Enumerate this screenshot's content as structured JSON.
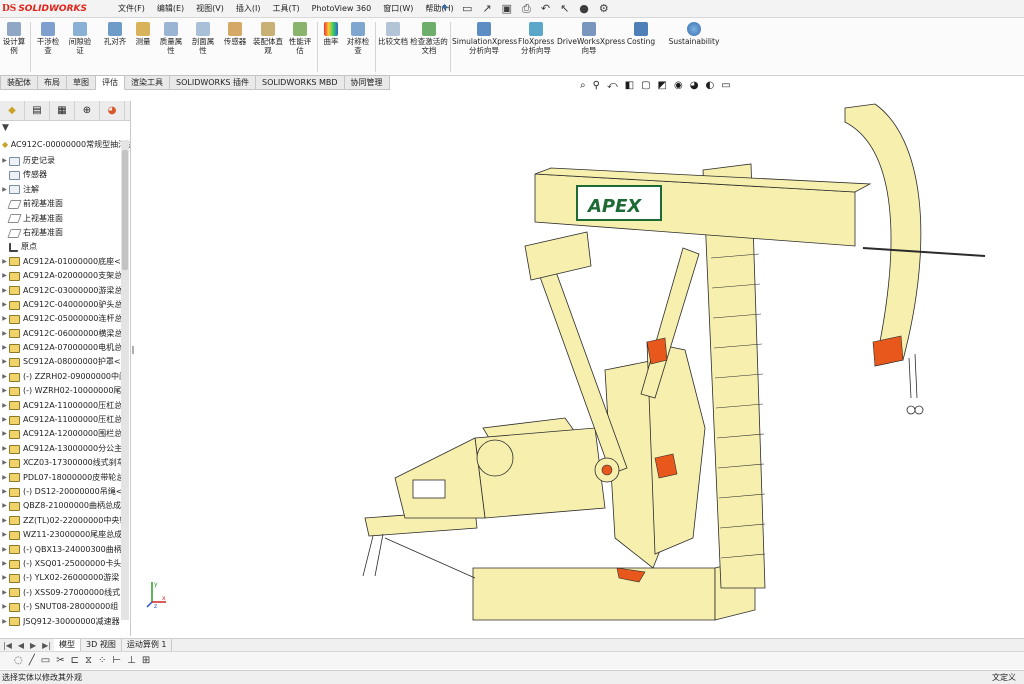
{
  "app": {
    "brand_ds": "DS",
    "brand_name": "SOLIDWORKS"
  },
  "menu": [
    "文件(F)",
    "编辑(E)",
    "视图(V)",
    "插入(I)",
    "工具(T)",
    "PhotoView 360",
    "窗口(W)",
    "帮助(H)"
  ],
  "quick_access": [
    "new-icon",
    "open-icon",
    "save-icon",
    "print-icon",
    "undo-icon",
    "select-icon",
    "rebuild-icon",
    "options-icon"
  ],
  "ribbon_tools": [
    {
      "label": "设计算例",
      "icon": "study-icon"
    },
    {
      "label": "干涉检查",
      "icon": "interference-icon"
    },
    {
      "label": "间隙验证",
      "icon": "clearance-icon"
    },
    {
      "label": "孔对齐",
      "icon": "hole-align-icon"
    },
    {
      "label": "测量",
      "icon": "measure-icon"
    },
    {
      "label": "质量属性",
      "icon": "mass-props-icon"
    },
    {
      "label": "剖面属性",
      "icon": "section-props-icon"
    },
    {
      "label": "传感器",
      "icon": "sensor-icon"
    },
    {
      "label": "装配体直观",
      "icon": "assembly-visual-icon"
    },
    {
      "label": "性能评估",
      "icon": "performance-icon"
    },
    {
      "label": "曲率",
      "icon": "curvature-icon"
    },
    {
      "label": "对称检查",
      "icon": "symmetry-icon"
    },
    {
      "label": "比较文档",
      "icon": "compare-icon"
    },
    {
      "label": "检查激活的文档",
      "icon": "check-doc-icon"
    },
    {
      "label": "SimulationXpress 分析向导",
      "icon": "simxpress-icon"
    },
    {
      "label": "FloXpress 分析向导",
      "icon": "floxpress-icon"
    },
    {
      "label": "DriveWorksXpress 向导",
      "icon": "driveworks-icon"
    },
    {
      "label": "Costing",
      "icon": "costing-icon"
    },
    {
      "label": "Sustainability",
      "icon": "sustainability-icon"
    }
  ],
  "tabs": [
    "装配体",
    "布局",
    "草图",
    "评估",
    "渲染工具",
    "SOLIDWORKS 插件",
    "SOLIDWORKS MBD",
    "协同管理"
  ],
  "active_tab": "评估",
  "view_toolbar": [
    "zoom-fit-icon",
    "zoom-area-icon",
    "previous-view-icon",
    "section-view-icon",
    "view-orientation-icon",
    "display-style-icon",
    "hide-show-icon",
    "edit-appearance-icon",
    "apply-scene-icon",
    "view-settings-icon"
  ],
  "panel_tabs": [
    "feature-manager-icon",
    "property-manager-icon",
    "config-manager-icon",
    "dimxpert-icon",
    "display-manager-icon"
  ],
  "tree": {
    "root": "AC912C-00000000常规型抽油机",
    "items": [
      {
        "label": "历史记录",
        "type": "feat",
        "expand": true
      },
      {
        "label": "传感器",
        "type": "feat",
        "expand": false
      },
      {
        "label": "注解",
        "type": "feat",
        "expand": true
      },
      {
        "label": "前视基准面",
        "type": "plane",
        "expand": false
      },
      {
        "label": "上视基准面",
        "type": "plane",
        "expand": false
      },
      {
        "label": "右视基准面",
        "type": "plane",
        "expand": false
      },
      {
        "label": "原点",
        "type": "origin",
        "expand": false
      },
      {
        "label": "AC912A-01000000底座<",
        "type": "part",
        "expand": true
      },
      {
        "label": "AC912A-02000000支架总",
        "type": "part",
        "expand": true
      },
      {
        "label": "AC912C-03000000游梁总",
        "type": "part",
        "expand": true
      },
      {
        "label": "AC912C-04000000驴头总",
        "type": "part",
        "expand": true
      },
      {
        "label": "AC912C-05000000连杆总",
        "type": "part",
        "expand": true
      },
      {
        "label": "AC912C-06000000横梁总",
        "type": "part",
        "expand": true
      },
      {
        "label": "AC912A-07000000电机总",
        "type": "part",
        "expand": true
      },
      {
        "label": "SC912A-08000000护罩<",
        "type": "part",
        "expand": true
      },
      {
        "label": "(-) ZZRH02-09000000中间",
        "type": "part",
        "expand": true
      },
      {
        "label": "(-) WZRH02-10000000尾",
        "type": "part",
        "expand": true
      },
      {
        "label": "AC912A-11000000压杠总",
        "type": "part",
        "expand": true
      },
      {
        "label": "AC912A-11000000压杠总",
        "type": "part",
        "expand": true
      },
      {
        "label": "AC912A-12000000围栏总",
        "type": "part",
        "expand": true
      },
      {
        "label": "AC912A-13000000分公主",
        "type": "part",
        "expand": true
      },
      {
        "label": "XCZ03-17300000线式刹车",
        "type": "part",
        "expand": true
      },
      {
        "label": "PDL07-18000000皮带轮总",
        "type": "part",
        "expand": true
      },
      {
        "label": "(-) DS12-20000000吊绳<",
        "type": "part",
        "expand": true
      },
      {
        "label": "QBZ8-21000000曲柄总成",
        "type": "part",
        "expand": true
      },
      {
        "label": "ZZ(TL)02-22000000中央轴",
        "type": "part",
        "expand": true
      },
      {
        "label": "WZ11-23000000尾座总成",
        "type": "part",
        "expand": true
      },
      {
        "label": "(-) QBX13-24000300曲柄",
        "type": "part",
        "expand": true
      },
      {
        "label": "(-) XSQ01-25000000卡头",
        "type": "part",
        "expand": true
      },
      {
        "label": "(-) YLX02-26000000游梁",
        "type": "part",
        "expand": true
      },
      {
        "label": "(-) XSS09-27000000线式",
        "type": "part",
        "expand": true
      },
      {
        "label": "(-) SNUT08-28000000组",
        "type": "part",
        "expand": true
      },
      {
        "label": "JSQ912-30000000减速器",
        "type": "part",
        "expand": true
      }
    ]
  },
  "bottom_tabs": [
    "模型",
    "3D 视图",
    "运动算例 1"
  ],
  "bottom_active": "模型",
  "sketch_tools": [
    "point-icon",
    "line-icon",
    "rectangle-icon",
    "trim-icon",
    "offset-icon",
    "mirror-icon",
    "pattern-icon",
    "dimension-icon",
    "relation-icon",
    "repair-icon"
  ],
  "status": {
    "left": "选择实体以修改其外观",
    "right": "文定义"
  },
  "model": {
    "brand_plate": "APEX",
    "body_color": "#f7efad",
    "accent_color": "#e8581c",
    "plate_color": "#1e6a35"
  }
}
